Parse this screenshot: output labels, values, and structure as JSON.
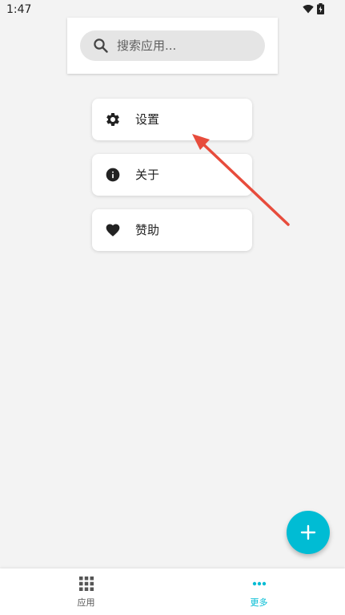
{
  "status_bar": {
    "time": "1:47",
    "icons": [
      "wifi-icon",
      "battery-icon"
    ]
  },
  "search": {
    "placeholder": "搜索应用..."
  },
  "menu": {
    "items": [
      {
        "label": "设置",
        "icon": "gear-icon"
      },
      {
        "label": "关于",
        "icon": "info-icon"
      },
      {
        "label": "赞助",
        "icon": "heart-icon"
      }
    ]
  },
  "fab": {
    "icon": "plus-icon"
  },
  "bottom_nav": {
    "items": [
      {
        "label": "应用",
        "icon": "grid-icon",
        "active": false
      },
      {
        "label": "更多",
        "icon": "more-icon",
        "active": true
      }
    ]
  },
  "colors": {
    "accent": "#00bcd4",
    "annotation_arrow": "#e74c3c",
    "inactive": "#555555"
  }
}
